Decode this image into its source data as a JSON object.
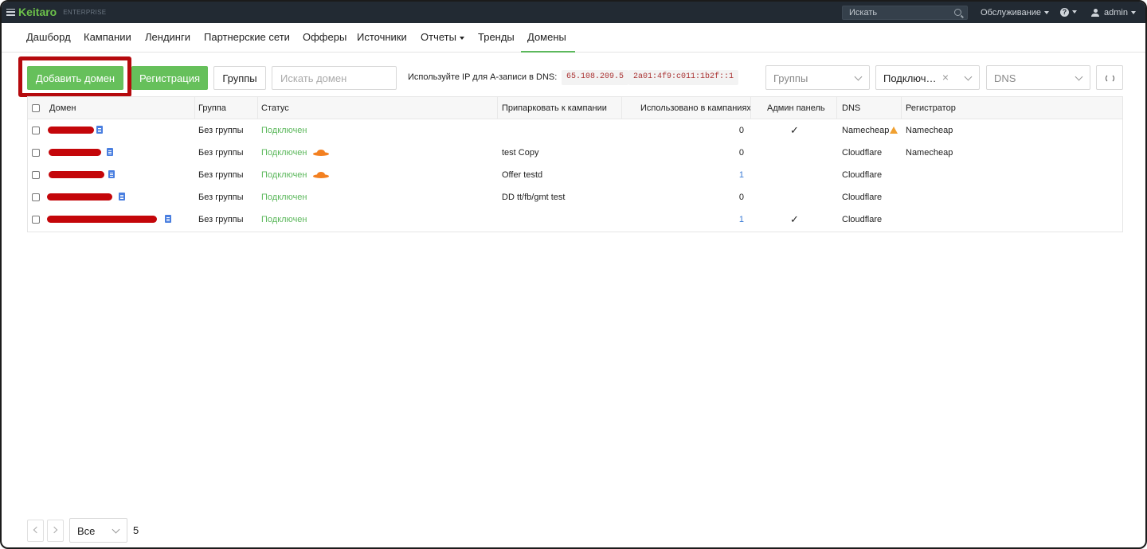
{
  "topbar": {
    "logo": "Keitaro",
    "edition": "ENTERPRISE",
    "search_placeholder": "Искать",
    "service_menu": "Обслуживание",
    "help_glyph": "?",
    "user": "admin"
  },
  "nav": {
    "items": [
      "Дашборд",
      "Кампании",
      "Лендинги",
      "Партнерские сети",
      "Офферы",
      "Источники",
      "Отчеты",
      "Тренды",
      "Домены"
    ],
    "active": "Домены"
  },
  "toolbar": {
    "add_domain": "Добавить домен",
    "registration": "Регистрация",
    "groups_button": "Группы",
    "search_placeholder": "Искать домен",
    "dns_hint": "Используйте IP для A-записи в DNS:",
    "ipv4": "65.108.209.5",
    "ipv6": "2a01:4f9:c011:1b2f::1",
    "filter_groups": "Группы",
    "filter_status": "Подключ…",
    "filter_dns": "DNS"
  },
  "table": {
    "columns": [
      "Домен",
      "Группа",
      "Статус",
      "Припарковать к кампании",
      "Использовано в кампаниях",
      "Админ панель",
      "DNS",
      "Регистратор"
    ],
    "rows": [
      {
        "group": "Без группы",
        "status": "Подключен",
        "cloudflare_icon": false,
        "campaign": "",
        "used": "0",
        "used_link": false,
        "admin": "✓",
        "dns": "Namecheap",
        "dns_warning": true,
        "registrar": "Namecheap"
      },
      {
        "group": "Без группы",
        "status": "Подключен",
        "cloudflare_icon": true,
        "campaign": "test Copy",
        "used": "0",
        "used_link": false,
        "admin": "",
        "dns": "Cloudflare",
        "dns_warning": false,
        "registrar": "Namecheap"
      },
      {
        "group": "Без группы",
        "status": "Подключен",
        "cloudflare_icon": true,
        "campaign": "Offer testd",
        "used": "1",
        "used_link": true,
        "admin": "",
        "dns": "Cloudflare",
        "dns_warning": false,
        "registrar": ""
      },
      {
        "group": "Без группы",
        "status": "Подключен",
        "cloudflare_icon": false,
        "campaign": "DD tt/fb/gmt test",
        "used": "0",
        "used_link": false,
        "admin": "",
        "dns": "Cloudflare",
        "dns_warning": false,
        "registrar": ""
      },
      {
        "group": "Без группы",
        "status": "Подключен",
        "cloudflare_icon": false,
        "campaign": "",
        "used": "1",
        "used_link": true,
        "admin": "✓",
        "dns": "Cloudflare",
        "dns_warning": false,
        "registrar": ""
      }
    ]
  },
  "pagination": {
    "per_page": "Все",
    "total": "5"
  },
  "colors": {
    "accent": "#66c05b",
    "highlight": "#b5090d",
    "topbar": "#222a33"
  }
}
